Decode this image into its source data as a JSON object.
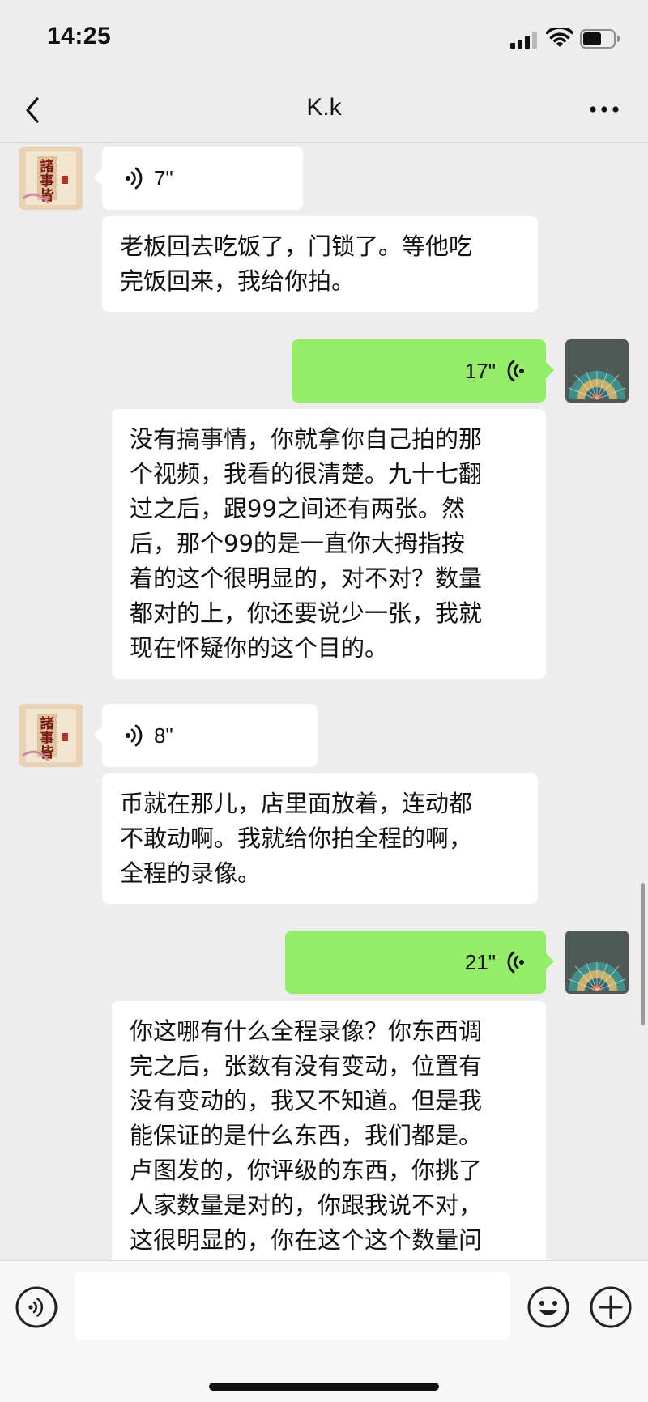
{
  "status_bar": {
    "time": "14:25"
  },
  "nav": {
    "title": "K.k"
  },
  "messages": [
    {
      "type": "voice",
      "side": "left",
      "duration": "7\""
    },
    {
      "type": "text",
      "side": "left",
      "lines": [
        "老板回去吃饭了，门锁了。等他吃",
        "完饭回来，我给你拍。"
      ]
    },
    {
      "type": "voice",
      "side": "right",
      "duration": "17\""
    },
    {
      "type": "text",
      "side": "right",
      "lines": [
        "没有搞事情，你就拿你自己拍的那",
        "个视频，我看的很清楚。九十七翻",
        "过之后，跟99之间还有两张。然",
        "后，那个99的是一直你大拇指按",
        "着的这个很明显的，对不对？数量",
        "都对的上，你还要说少一张，我就",
        "现在怀疑你的这个目的。"
      ]
    },
    {
      "type": "voice",
      "side": "left",
      "duration": "8\""
    },
    {
      "type": "text",
      "side": "left",
      "lines": [
        "币就在那儿，店里面放着，连动都",
        "不敢动啊。我就给你拍全程的啊，",
        "全程的录像。"
      ]
    },
    {
      "type": "voice",
      "side": "right",
      "duration": "21\""
    },
    {
      "type": "text",
      "side": "right",
      "lines": [
        "你这哪有什么全程录像？你东西调",
        "完之后，张数有没有变动，位置有",
        "没有变动的，我又不知道。但是我",
        "能保证的是什么东西，我们都是。",
        "卢图发的，你评级的东西，你挑了",
        "人家数量是对的，你跟我说不对，",
        "这很明显的，你在这个这个数量问"
      ]
    }
  ],
  "avatar_left": {
    "text": "諸事皆順",
    "colors": {
      "bg": "#e9d2b4",
      "ink": "#7a1a12"
    }
  },
  "colors": {
    "sent_bubble": "#95ec69",
    "received_bubble": "#ffffff",
    "background": "#ededed"
  },
  "input_bar": {
    "placeholder": ""
  }
}
